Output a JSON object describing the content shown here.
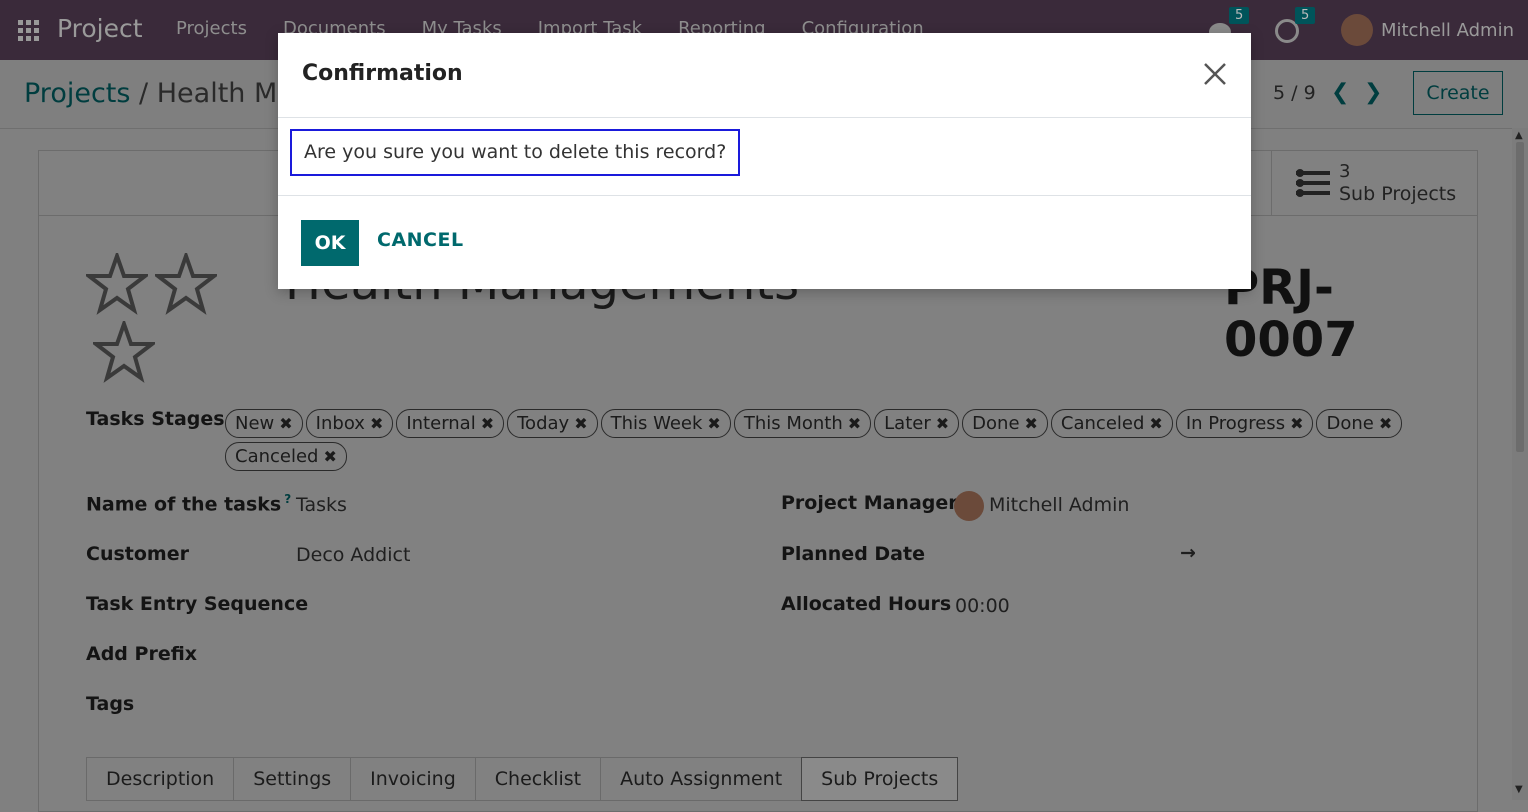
{
  "navbar": {
    "brand": "Project",
    "menu": [
      "Projects",
      "Documents",
      "My Tasks",
      "Import Task",
      "Reporting",
      "Configuration"
    ],
    "messages_count": "5",
    "activities_count": "5",
    "user_name": "Mitchell Admin"
  },
  "control_panel": {
    "breadcrumb_root": "Projects",
    "breadcrumb_separator": "/",
    "breadcrumb_current": "Health Ma",
    "pager": "5 / 9",
    "create_label": "Create"
  },
  "form": {
    "subprojects_count": "3",
    "subprojects_label": "Sub Projects",
    "title": "Health Managements",
    "code": "PRJ-0007",
    "tasks_stages_label": "Tasks Stages",
    "stages": [
      "New",
      "Inbox",
      "Internal",
      "Today",
      "This Week",
      "This Month",
      "Later",
      "Done",
      "Canceled",
      "In Progress",
      "Done",
      "Canceled"
    ],
    "name_of_tasks_label": "Name of the tasks",
    "name_of_tasks_help": "?",
    "name_of_tasks_value": "Tasks",
    "customer_label": "Customer",
    "customer_value": "Deco Addict",
    "task_entry_sequence_label": "Task Entry Sequence",
    "add_prefix_label": "Add Prefix",
    "tags_label": "Tags",
    "project_manager_label": "Project Manager",
    "project_manager_value": "Mitchell Admin",
    "planned_date_label": "Planned Date",
    "planned_date_arrow": "→",
    "allocated_hours_label": "Allocated Hours",
    "allocated_hours_value": "00:00",
    "tabs": [
      "Description",
      "Settings",
      "Invoicing",
      "Checklist",
      "Auto Assignment",
      "Sub Projects"
    ]
  },
  "modal": {
    "title": "Confirmation",
    "message": "Are you sure you want to delete this record?",
    "ok_label": "OK",
    "cancel_label": "CANCEL"
  },
  "colors": {
    "primary": "#00696d",
    "navbar": "#3a2a3a",
    "highlight_border": "#1a1adb"
  }
}
